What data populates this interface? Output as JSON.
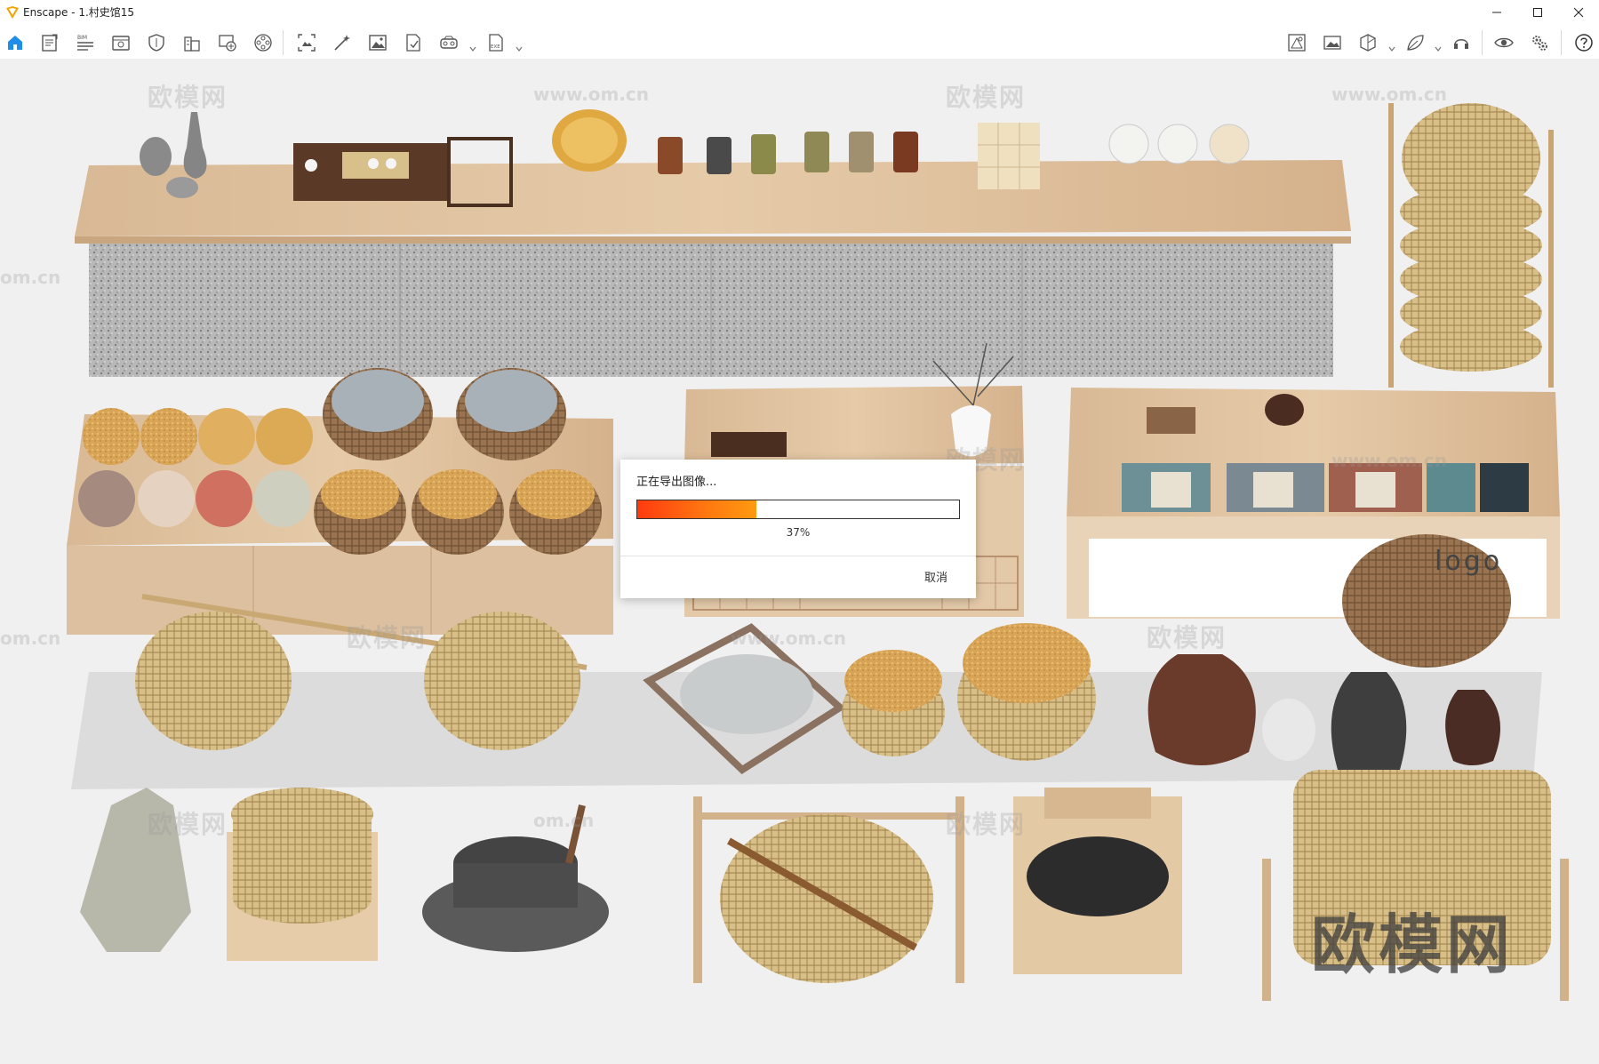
{
  "window": {
    "app_name": "Enscape",
    "title": "Enscape - 1.村史馆15"
  },
  "toolbar": {
    "left_icons": [
      "home-icon",
      "document-icon",
      "bim-icon",
      "view-icon",
      "shield-icon",
      "building-icon",
      "capture-icon",
      "film-reel-icon",
      "screenshot-icon",
      "magic-wand-icon",
      "image-icon",
      "export-file-icon",
      "vr-headset-icon",
      "exe-export-icon"
    ],
    "right_icons": [
      "asset-library-icon",
      "image-gallery-icon",
      "cube-view-icon",
      "leaf-icon",
      "headset-icon",
      "eye-icon",
      "settings-gears-icon",
      "help-icon"
    ],
    "bim_label": "BIM",
    "exe_label": "EXE"
  },
  "viewport": {
    "watermark_text": "欧模网",
    "watermark_url": "www.om.cn",
    "watermark_url_short": "om.cn",
    "big_watermark": "欧模网",
    "sign_text": "logo"
  },
  "dialog": {
    "title": "正在导出图像...",
    "progress_percent": 37,
    "progress_label": "37%",
    "cancel_label": "取消"
  },
  "colors": {
    "brand": "#f5a300",
    "toolbar_icon": "#555555",
    "home_active": "#1e8ee8",
    "progress_start": "#ff3a10",
    "progress_end": "#ff9a10"
  }
}
